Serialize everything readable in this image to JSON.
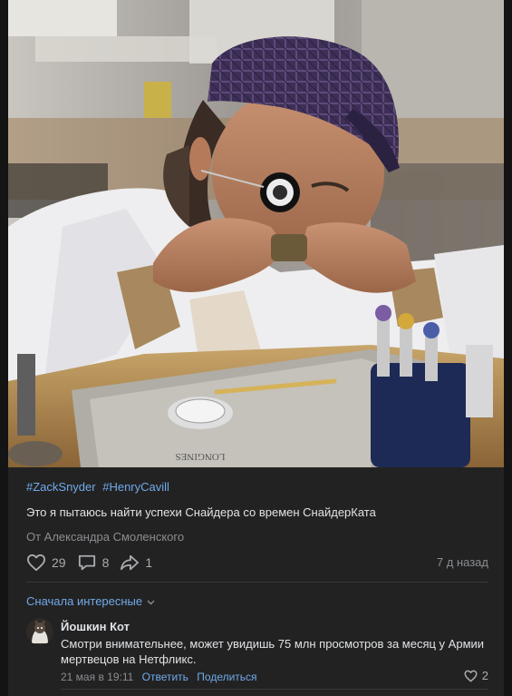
{
  "post": {
    "hashtags": [
      "#ZackSnyder",
      "#HenryCavill"
    ],
    "text": "Это я пытаюсь найти успехи Снайдера со времен СнайдерКата",
    "author": "От Александра Смоленского",
    "likes": "29",
    "comments": "8",
    "shares": "1",
    "date": "7 д назад",
    "photo_logo_text": "LONGINES"
  },
  "comments_section": {
    "sort_label": "Сначала интересные",
    "items": [
      {
        "name": "Йошкин Кот",
        "text": "Смотри внимательнее, может увидишь 75 млн просмотров за месяц у Армии мертвецов на Нетфликс.",
        "date": "21 мая в 19:11",
        "reply_label": "Ответить",
        "share_label": "Поделиться",
        "likes": "2"
      }
    ]
  },
  "colors": {
    "background": "#141414",
    "card": "#222222",
    "link": "#71aaeb",
    "text": "#e1e3e6",
    "secondary": "#8a8d91"
  }
}
